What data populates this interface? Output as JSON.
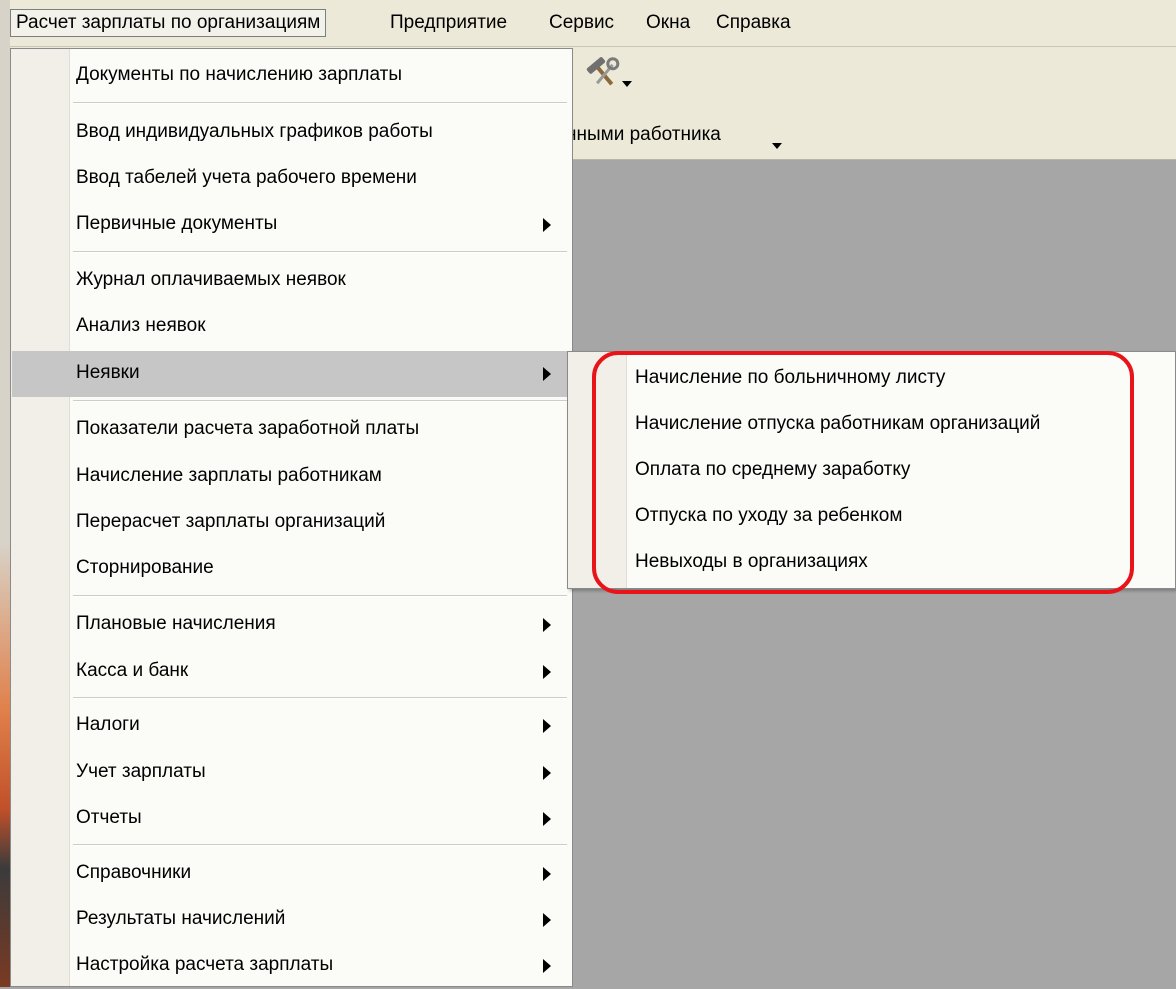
{
  "menubar": {
    "items": [
      {
        "label": "Расчет зарплаты по организациям"
      },
      {
        "label": "Предприятие"
      },
      {
        "label": "Сервис"
      },
      {
        "label": "Окна"
      },
      {
        "label": "Справка"
      }
    ]
  },
  "toolbar": {
    "icon": "tools-icon",
    "partial_text": "нными работника"
  },
  "menu": {
    "items": [
      {
        "label": "Документы по начислению зарплаты",
        "submenu": false
      },
      {
        "label": "Ввод индивидуальных графиков работы",
        "submenu": false
      },
      {
        "label": "Ввод табелей учета рабочего времени",
        "submenu": false
      },
      {
        "label": "Первичные документы",
        "submenu": true
      },
      {
        "label": "Журнал оплачиваемых неявок",
        "submenu": false
      },
      {
        "label": "Анализ неявок",
        "submenu": false
      },
      {
        "label": "Неявки",
        "submenu": true,
        "highlighted": true
      },
      {
        "label": "Показатели расчета заработной платы",
        "submenu": false
      },
      {
        "label": "Начисление зарплаты работникам",
        "submenu": false
      },
      {
        "label": "Перерасчет зарплаты организаций",
        "submenu": false
      },
      {
        "label": "Сторнирование",
        "submenu": false
      },
      {
        "label": "Плановые начисления",
        "submenu": true
      },
      {
        "label": "Касса и банк",
        "submenu": true
      },
      {
        "label": "Налоги",
        "submenu": true
      },
      {
        "label": "Учет зарплаты",
        "submenu": true
      },
      {
        "label": "Отчеты",
        "submenu": true
      },
      {
        "label": "Справочники",
        "submenu": true
      },
      {
        "label": "Результаты начислений",
        "submenu": true
      },
      {
        "label": "Настройка расчета зарплаты",
        "submenu": true
      }
    ]
  },
  "submenu": {
    "items": [
      {
        "label": "Начисление по больничному листу"
      },
      {
        "label": "Начисление отпуска работникам организаций"
      },
      {
        "label": "Оплата по среднему заработку"
      },
      {
        "label": "Отпуска по уходу за ребенком"
      },
      {
        "label": "Невыходы в организациях"
      }
    ],
    "annotation_color": "#e8141a"
  },
  "colors": {
    "workspace": "#a6a6a6",
    "menu_bg": "#fbfbf8",
    "menubar_bg": "#ece9d8",
    "hover": "#c6c6c6"
  }
}
